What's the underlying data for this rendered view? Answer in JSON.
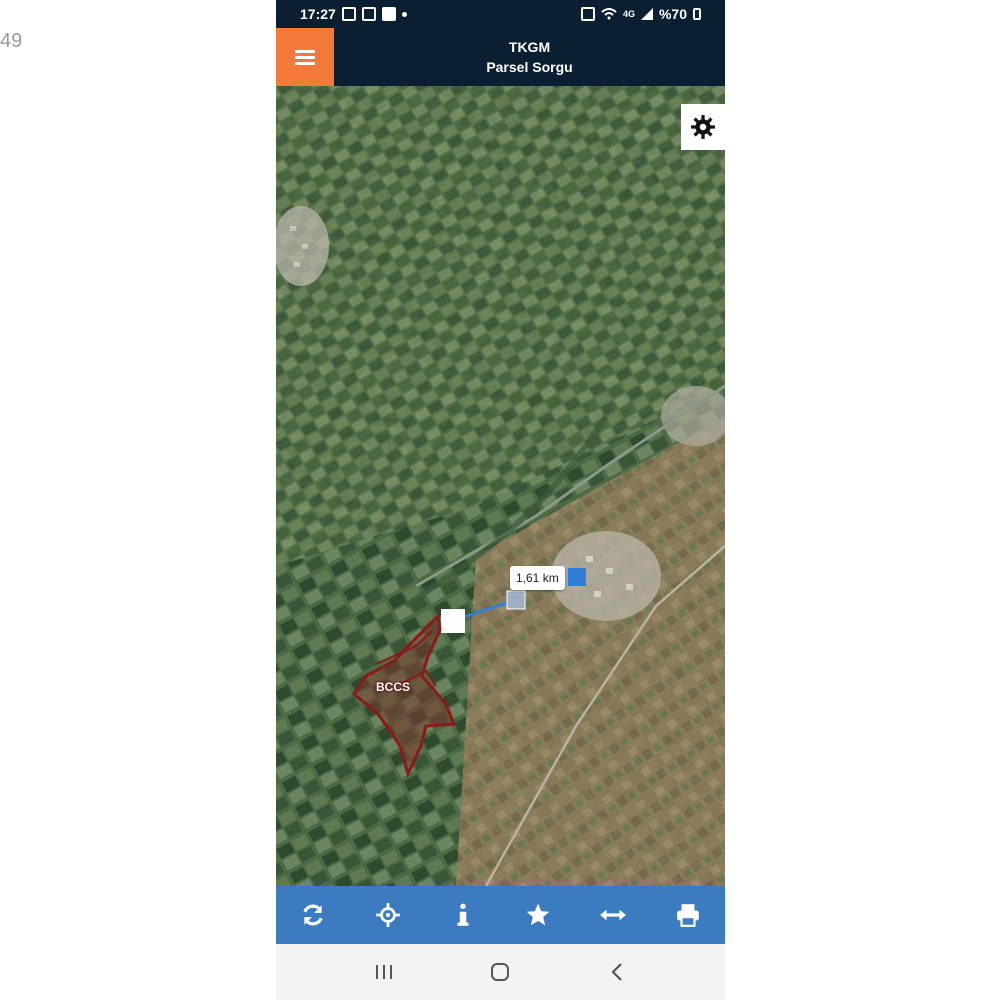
{
  "edge_text": "49",
  "status_bar": {
    "time": "17:27",
    "battery_text": "%70",
    "network_text": "4G"
  },
  "header": {
    "title": "TKGM",
    "subtitle": "Parsel Sorgu"
  },
  "map": {
    "distance_label": "1,61 km",
    "parcel_label": "BCCS"
  },
  "toolbar": {
    "icons": [
      "refresh-icon",
      "locate-icon",
      "info-icon",
      "star-icon",
      "measure-icon",
      "print-icon"
    ]
  },
  "nav_bar": {
    "icons": [
      "recent-apps-icon",
      "home-icon",
      "back-icon"
    ]
  },
  "colors": {
    "header_bg": "#0b1f33",
    "menu_accent": "#f47a3a",
    "toolbar_bg": "#3b7bc0",
    "parcel_outline": "#8b1a1a",
    "measure_line": "#2f7fd6"
  }
}
